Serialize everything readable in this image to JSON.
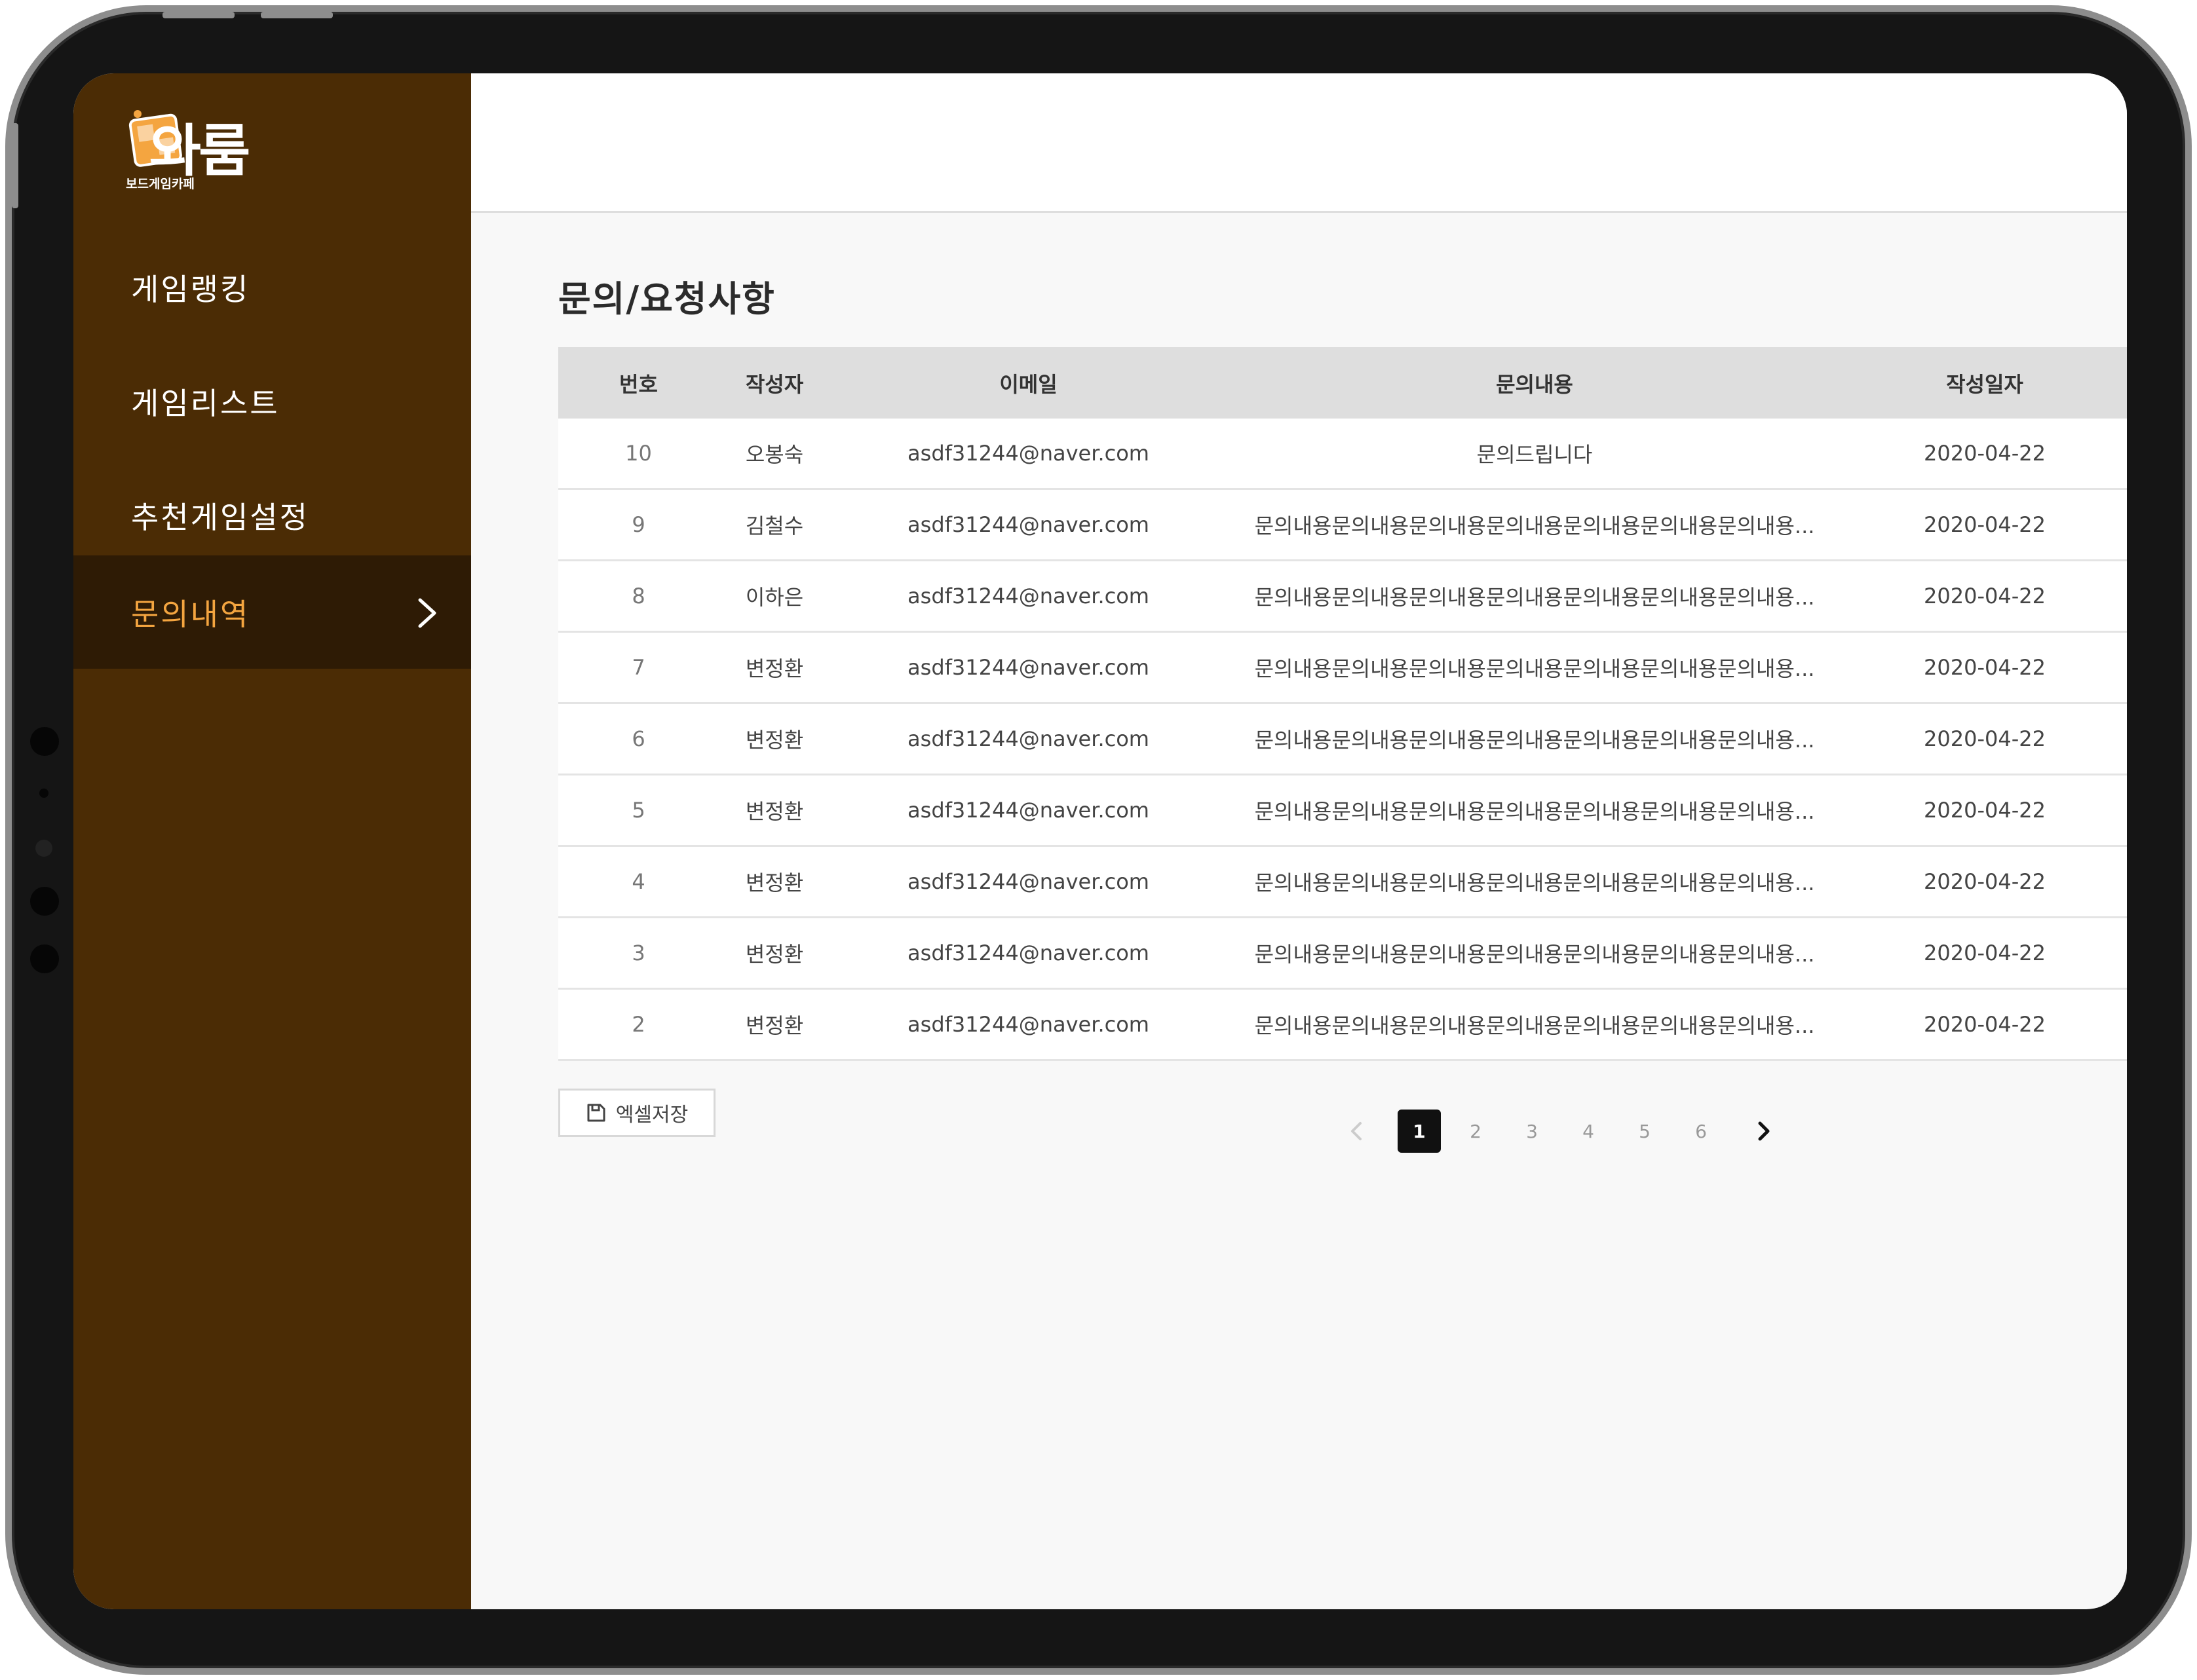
{
  "brand": {
    "logo_text": "와룸",
    "logo_sub": "보드게임카페"
  },
  "sidebar": {
    "items": [
      {
        "label": "게임랭킹",
        "active": false
      },
      {
        "label": "게임리스트",
        "active": false
      },
      {
        "label": "추천게임설정",
        "active": false
      },
      {
        "label": "문의내역",
        "active": true
      }
    ]
  },
  "page": {
    "title": "문의/요청사항"
  },
  "table": {
    "headers": [
      "번호",
      "작성자",
      "이메일",
      "문의내용",
      "작성일자"
    ],
    "rows": [
      [
        "10",
        "오봉숙",
        "asdf31244@naver.com",
        "문의드립니다",
        "2020-04-22"
      ],
      [
        "9",
        "김철수",
        "asdf31244@naver.com",
        "문의내용문의내용문의내용문의내용문의내용문의내용문의내용...",
        "2020-04-22"
      ],
      [
        "8",
        "이하은",
        "asdf31244@naver.com",
        "문의내용문의내용문의내용문의내용문의내용문의내용문의내용...",
        "2020-04-22"
      ],
      [
        "7",
        "변정환",
        "asdf31244@naver.com",
        "문의내용문의내용문의내용문의내용문의내용문의내용문의내용...",
        "2020-04-22"
      ],
      [
        "6",
        "변정환",
        "asdf31244@naver.com",
        "문의내용문의내용문의내용문의내용문의내용문의내용문의내용...",
        "2020-04-22"
      ],
      [
        "5",
        "변정환",
        "asdf31244@naver.com",
        "문의내용문의내용문의내용문의내용문의내용문의내용문의내용...",
        "2020-04-22"
      ],
      [
        "4",
        "변정환",
        "asdf31244@naver.com",
        "문의내용문의내용문의내용문의내용문의내용문의내용문의내용...",
        "2020-04-22"
      ],
      [
        "3",
        "변정환",
        "asdf31244@naver.com",
        "문의내용문의내용문의내용문의내용문의내용문의내용문의내용...",
        "2020-04-22"
      ],
      [
        "2",
        "변정환",
        "asdf31244@naver.com",
        "문의내용문의내용문의내용문의내용문의내용문의내용문의내용...",
        "2020-04-22"
      ]
    ]
  },
  "actions": {
    "excel_label": "엑셀저장"
  },
  "pagination": {
    "pages": [
      "1",
      "2",
      "3",
      "4",
      "5",
      "6"
    ],
    "current": "1"
  },
  "colors": {
    "sidebar_bg": "#4b2c05",
    "sidebar_active_bg": "#2e1b05",
    "active_text": "#f4a540",
    "logo_accent": "#f4a540"
  },
  "icons": {
    "nav_active": "chevron-right-icon",
    "excel": "save-icon",
    "prev": "chevron-left-icon",
    "next": "chevron-right-icon"
  }
}
